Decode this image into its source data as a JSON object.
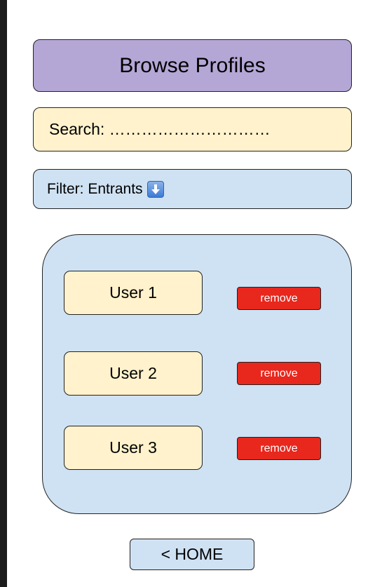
{
  "header": {
    "title": "Browse Profiles"
  },
  "search": {
    "label": "Search: …………………………"
  },
  "filter": {
    "label": "Filter: Entrants",
    "icon": "arrow-down-icon"
  },
  "users": [
    {
      "name": "User 1",
      "action": "remove"
    },
    {
      "name": "User 2",
      "action": "remove"
    },
    {
      "name": "User 3",
      "action": "remove"
    }
  ],
  "nav": {
    "home_label": "< HOME"
  },
  "colors": {
    "title_bg": "#b4a7d6",
    "search_bg": "#fff2cc",
    "panel_bg": "#cfe2f3",
    "remove_bg": "#e8271d"
  }
}
